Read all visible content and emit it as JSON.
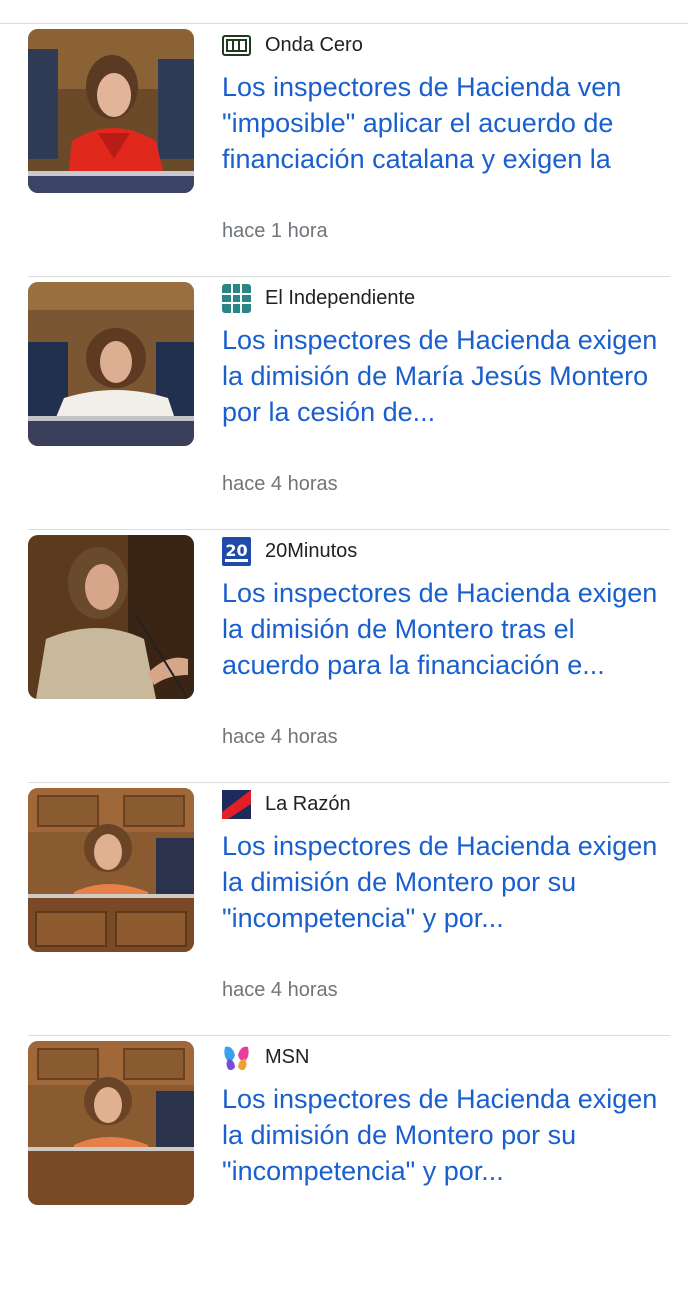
{
  "articles": [
    {
      "source": "Onda Cero",
      "logo_icon": "onda-cero-logo-icon",
      "headline": "Los inspectores de Hacienda ven \"imposible\" aplicar el acuerdo de financiación catalana y exigen la",
      "time": "hace 1 hora",
      "thumbnail": "woman-in-red-jacket-parliament-photo"
    },
    {
      "source": "El Independiente",
      "logo_icon": "el-independiente-logo-icon",
      "headline": "Los inspectores de Hacienda exigen la dimisión de María Jesús Montero por la cesión de...",
      "time": "hace 4 horas",
      "thumbnail": "woman-in-white-parliament-photo"
    },
    {
      "source": "20Minutos",
      "logo_icon": "20minutos-logo-icon",
      "headline": "Los inspectores de Hacienda exigen la dimisión de Montero tras el acuerdo para la financiación e...",
      "time": "hace 4 horas",
      "thumbnail": "woman-speaking-at-podium-photo"
    },
    {
      "source": "La Razón",
      "logo_icon": "la-razon-logo-icon",
      "headline": "Los inspectores de Hacienda exigen la dimisión de Montero por su \"incompetencia\" y por...",
      "time": "hace 4 horas",
      "thumbnail": "woman-smiling-in-parliament-photo"
    },
    {
      "source": "MSN",
      "logo_icon": "msn-logo-icon",
      "headline": "Los inspectores de Hacienda exigen la dimisión de Montero por su \"incompetencia\" y por...",
      "time": "",
      "thumbnail": "woman-smiling-in-parliament-photo"
    }
  ],
  "colors": {
    "headline": "#1a5fce",
    "source": "#202124",
    "time": "#70757a",
    "divider": "#dadce0"
  }
}
